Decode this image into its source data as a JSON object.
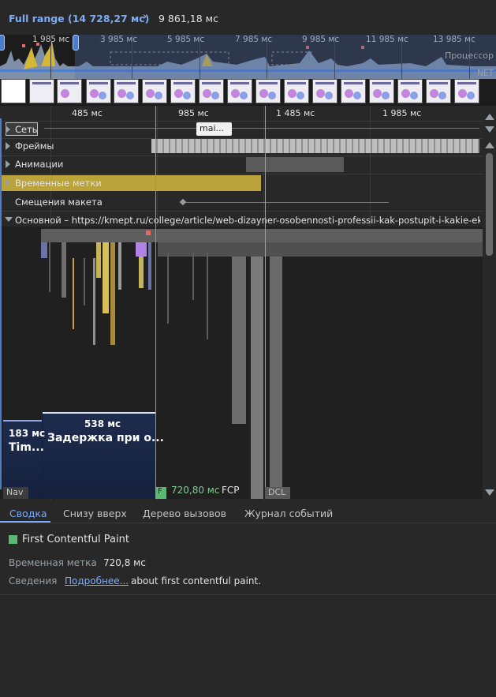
{
  "breadcrumb": {
    "full_range": "Full range (14 728,27 мс)",
    "separator": "›",
    "current": "9 861,18 мс"
  },
  "overview": {
    "ticks": [
      "1 985 мс",
      "3 985 мс",
      "5 985 мс",
      "7 985 мс",
      "9 985 мс",
      "11 985 мс",
      "13 985 мс"
    ],
    "cpu_label": "Процессор",
    "net_label": "NET"
  },
  "ruler": {
    "ticks": [
      "485 мс",
      "985 мс",
      "1 485 мс",
      "1 985 мс"
    ]
  },
  "tracks": {
    "network": {
      "label": "Сеть",
      "tooltip": "mai..."
    },
    "frames": {
      "label": "Фреймы"
    },
    "animations": {
      "label": "Анимации"
    },
    "timings": {
      "label": "Временные метки"
    },
    "layout_shifts": {
      "label": "Смещения макета"
    },
    "main": {
      "label": "Основной – https://kmept.ru/college/article/web-dizayner-osobennosti-professii-kak-postupit-i-kakie-ekzam"
    }
  },
  "flame": {
    "ltb1_ms": "183 мс",
    "ltb1_name": "Tim...",
    "ltb2_ms": "538 мс",
    "ltb2_name": "Задержка при о...",
    "nav_tag": "Nav",
    "fcp_tag": "F",
    "fcp_time": "720,80 мс",
    "fcp_name": "FCP",
    "dcl_tag": "DCL"
  },
  "bottom_tabs": [
    "Сводка",
    "Снизу вверх",
    "Дерево вызовов",
    "Журнал событий"
  ],
  "summary": {
    "title": "First Contentful Paint",
    "swatch_color": "#5bb974",
    "timestamp_label": "Временная метка",
    "timestamp_value": "720,8 мс",
    "details_label": "Сведения",
    "details_link": "Подробнее...",
    "details_rest": "about first contentful paint."
  },
  "colors": {
    "accent": "#7cacf8",
    "timings_track": "#b9a33a",
    "fcp": "#5bb974"
  }
}
